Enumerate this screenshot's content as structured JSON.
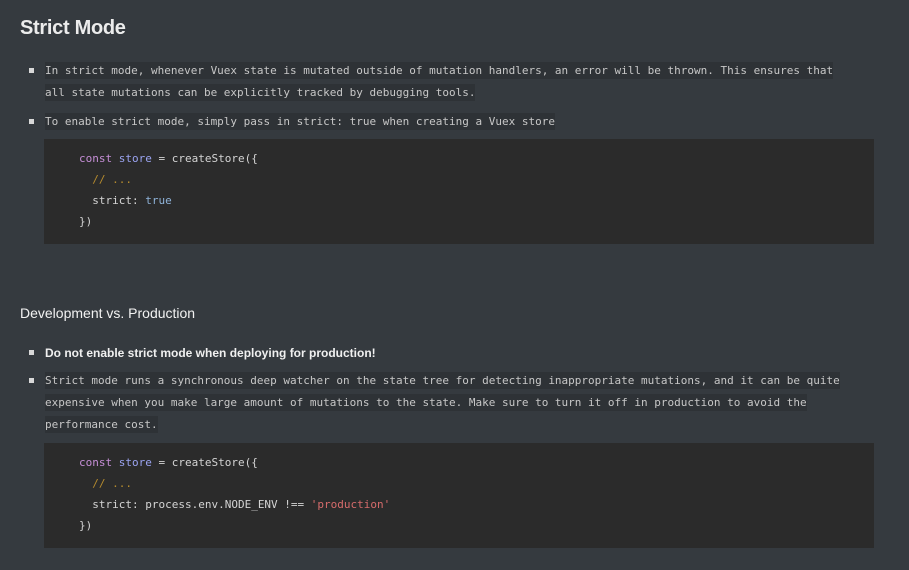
{
  "section1": {
    "title": "Strict Mode",
    "bullets": [
      "In strict mode, whenever Vuex state is mutated outside of mutation handlers, an error will be thrown. This ensures that",
      "all state mutations can be explicitly tracked by debugging tools.",
      "To enable strict mode, simply pass in strict: true when creating a Vuex store"
    ],
    "code": {
      "line1_kw": "const",
      "line1_var": "store",
      "line1_rest": " = createStore({",
      "line2_comment": "// ...",
      "line3_key": "strict: ",
      "line3_value": "true",
      "line4": "})"
    }
  },
  "section2": {
    "title": "Development vs. Production",
    "bold_bullet": "Do not enable strict mode when deploying for production!",
    "bullet_lines": [
      "Strict mode runs a synchronous deep watcher on the state tree for detecting inappropriate mutations, and it can be quite",
      "expensive when you make large amount of mutations to the state. Make sure to turn it off in production to avoid the",
      "performance cost."
    ],
    "code": {
      "line1_kw": "const",
      "line1_var": "store",
      "line1_rest": " = createStore({",
      "line2_comment": "// ...",
      "line3_key": "strict: process.env.NODE_ENV !== ",
      "line3_value": "'production'",
      "line4": "})"
    }
  }
}
